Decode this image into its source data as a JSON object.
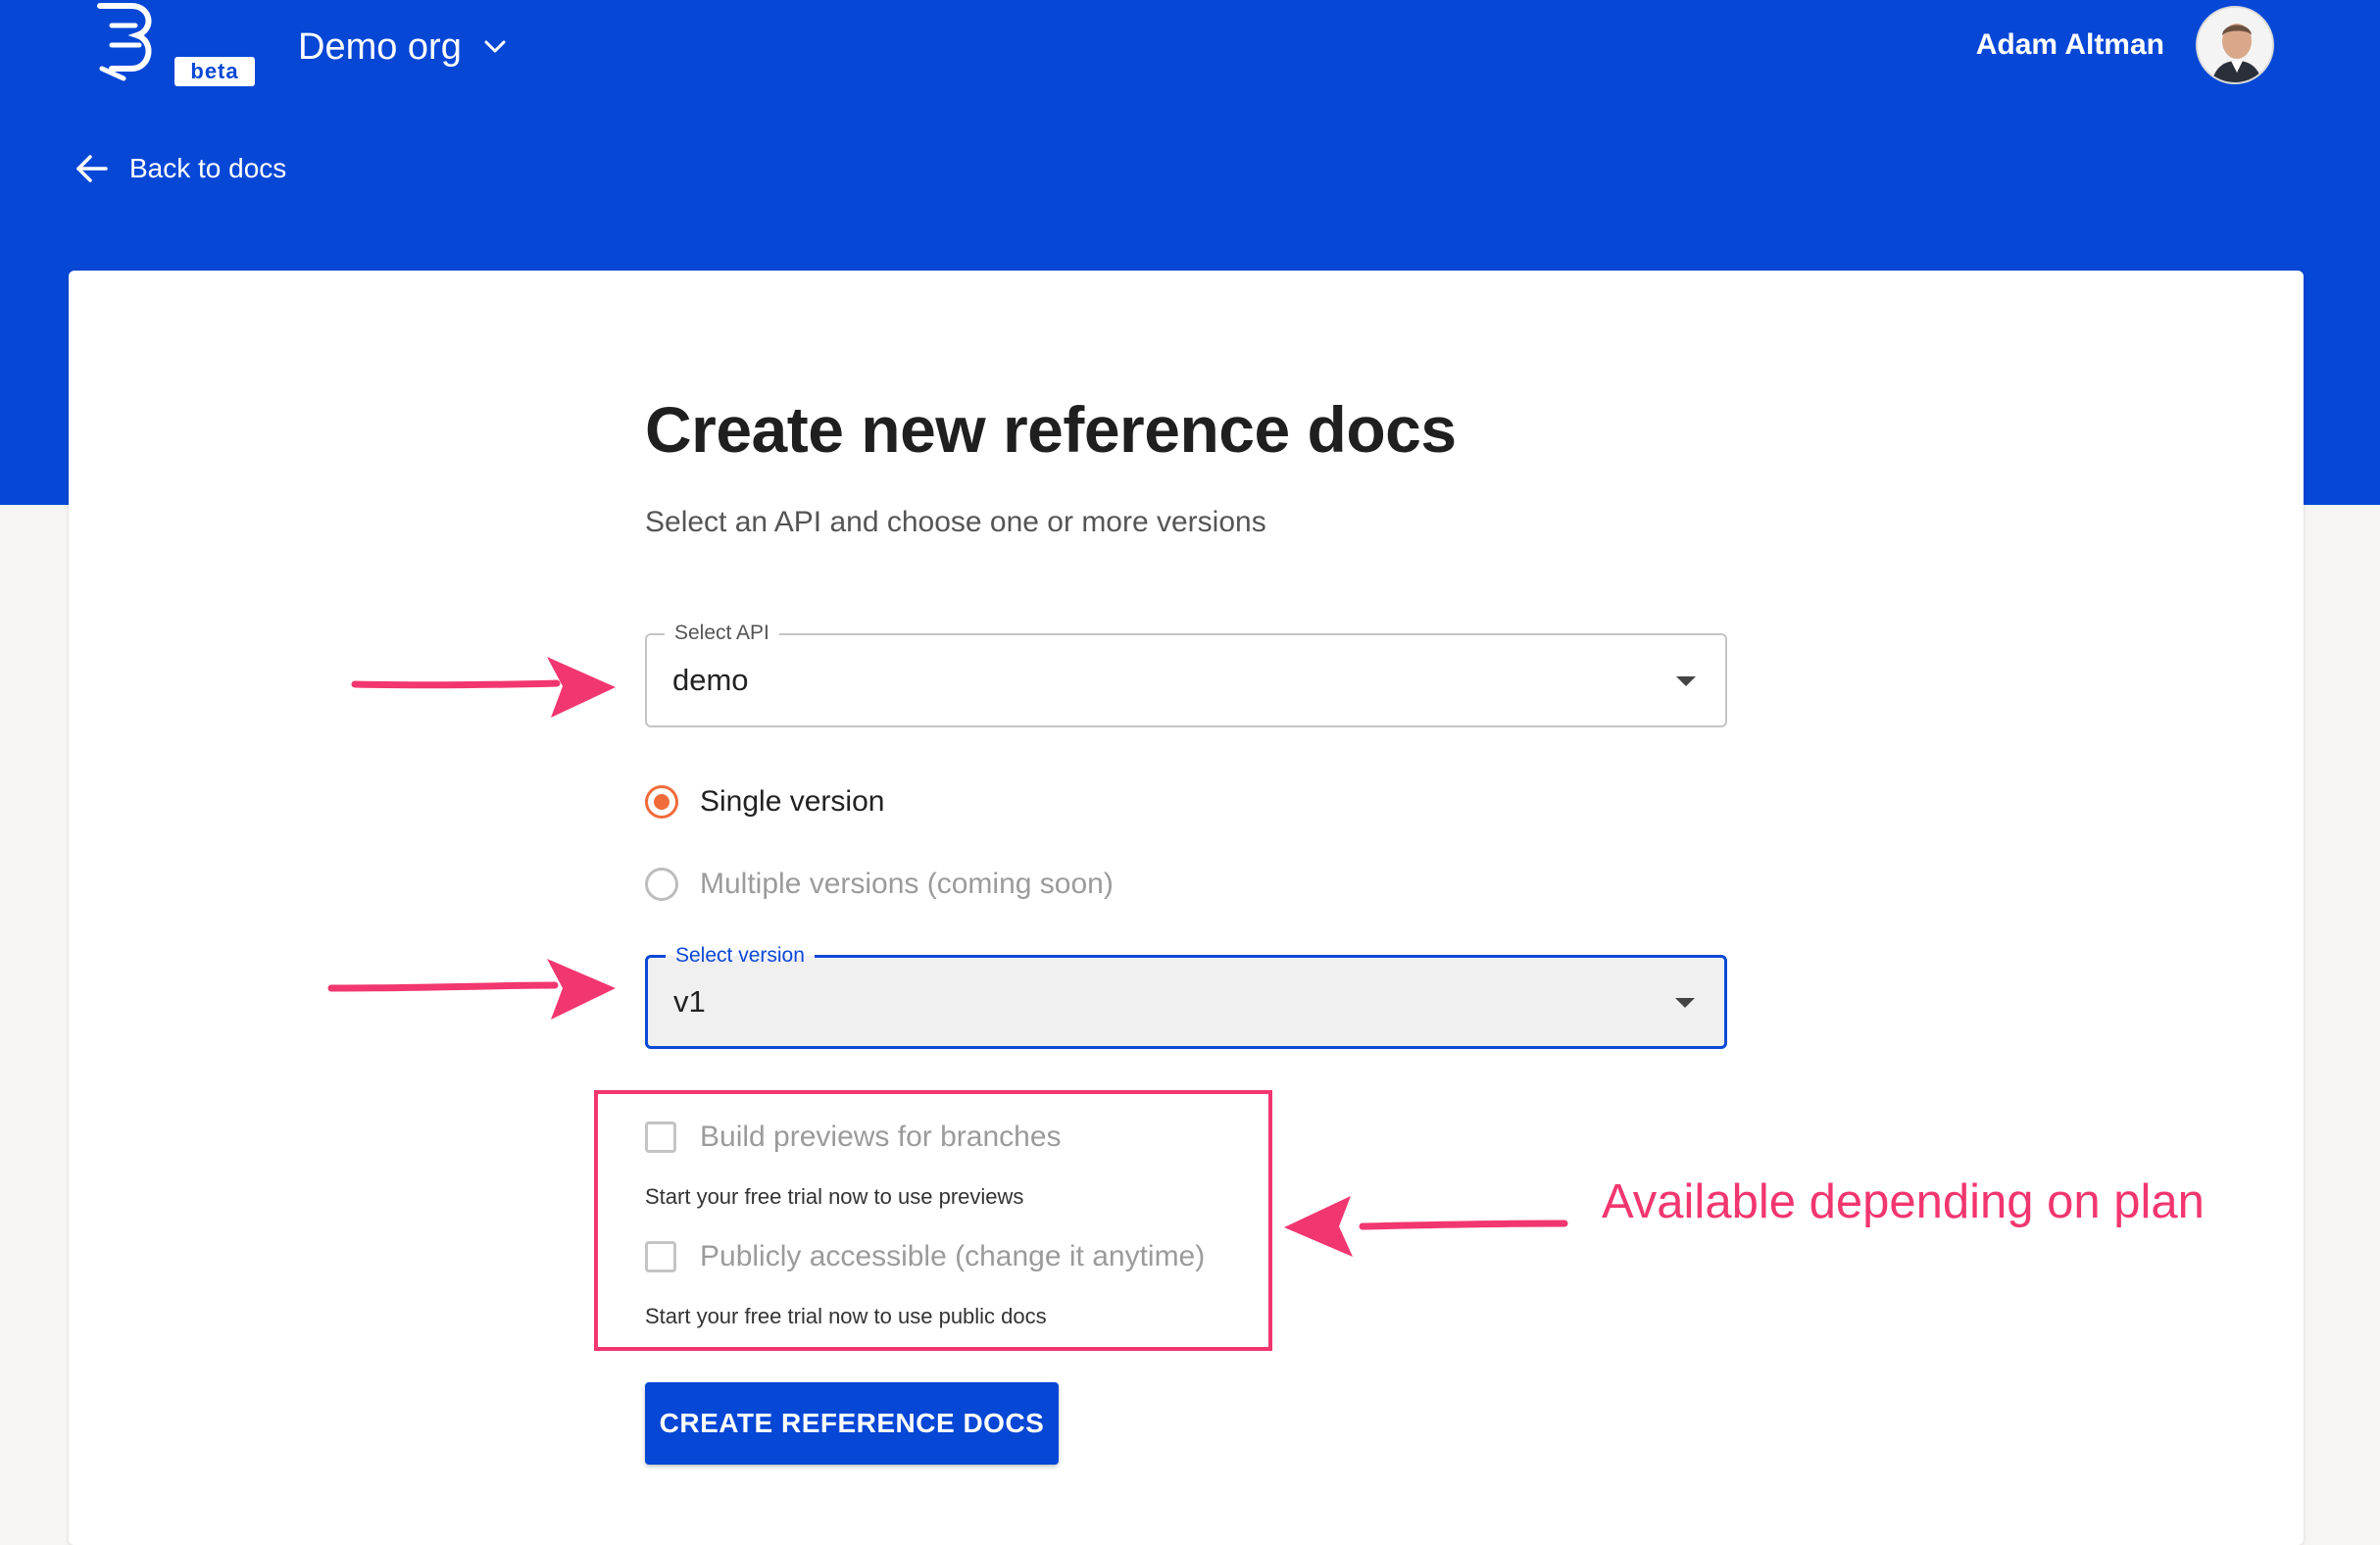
{
  "header": {
    "logo_badge": "beta",
    "org_name": "Demo org",
    "user_name": "Adam Altman"
  },
  "nav": {
    "back_label": "Back to docs"
  },
  "form": {
    "title": "Create new reference docs",
    "subtitle": "Select an API and choose one or more versions",
    "select_api": {
      "label": "Select API",
      "value": "demo"
    },
    "radio_options": [
      {
        "label": "Single version",
        "checked": true,
        "disabled": false
      },
      {
        "label": "Multiple versions (coming soon)",
        "checked": false,
        "disabled": true
      }
    ],
    "select_version": {
      "label": "Select version",
      "value": "v1"
    },
    "checkboxes": [
      {
        "label": "Build previews for branches",
        "helper": "Start your free trial now to use previews",
        "checked": false,
        "disabled": true
      },
      {
        "label": "Publicly accessible (change it anytime)",
        "helper": "Start your free trial now to use public docs",
        "checked": false,
        "disabled": true
      }
    ],
    "submit_label": "CREATE REFERENCE DOCS"
  },
  "annotations": {
    "plan_note": "Available depending on plan",
    "color": "#f2366f"
  },
  "colors": {
    "brand_blue": "#0747d6",
    "radio_accent": "#f26b3a",
    "focus_blue": "#0a48d6"
  }
}
